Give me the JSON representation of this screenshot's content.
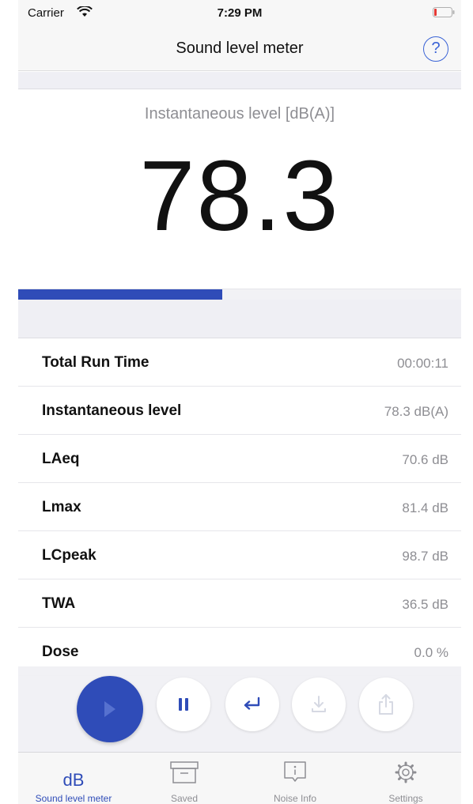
{
  "status_bar": {
    "carrier": "Carrier",
    "time": "7:29 PM",
    "battery_color": "#e53935"
  },
  "nav": {
    "title": "Sound level meter",
    "help_label": "?"
  },
  "meter": {
    "label": "Instantaneous level [dB(A)]",
    "value": "78.3",
    "level_fraction": 0.46,
    "accent": "#2f4cb8"
  },
  "stats": [
    {
      "label": "Total Run Time",
      "value": "00:00:11"
    },
    {
      "label": "Instantaneous level",
      "value": "78.3 dB(A)"
    },
    {
      "label": "LAeq",
      "value": "70.6 dB"
    },
    {
      "label": "Lmax",
      "value": "81.4 dB"
    },
    {
      "label": "LCpeak",
      "value": "98.7 dB"
    },
    {
      "label": "TWA",
      "value": "36.5 dB"
    },
    {
      "label": "Dose",
      "value": "0.0 %"
    }
  ],
  "controls": [
    {
      "name": "play",
      "icon": "play-icon",
      "enabled": true
    },
    {
      "name": "pause",
      "icon": "pause-icon",
      "enabled": true
    },
    {
      "name": "reset",
      "icon": "return-icon",
      "enabled": true
    },
    {
      "name": "save",
      "icon": "download-icon",
      "enabled": false
    },
    {
      "name": "share",
      "icon": "share-icon",
      "enabled": false
    }
  ],
  "tabs": [
    {
      "label": "Sound level meter",
      "glyph": "dB",
      "icon": "db-icon",
      "active": true
    },
    {
      "label": "Saved",
      "icon": "archive-box-icon",
      "active": false
    },
    {
      "label": "Noise Info",
      "icon": "info-icon",
      "active": false
    },
    {
      "label": "Settings",
      "icon": "gear-icon",
      "active": false
    }
  ]
}
